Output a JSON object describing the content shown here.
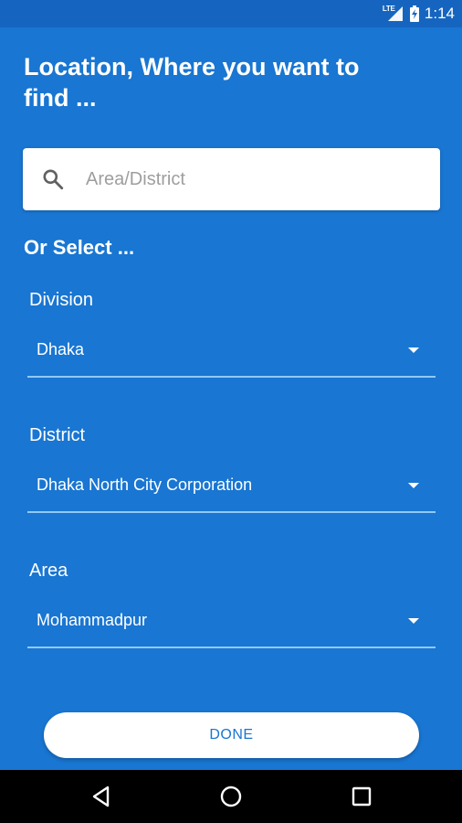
{
  "status_bar": {
    "network": "LTE",
    "time": "1:14"
  },
  "page": {
    "title": "Location, Where you want to find ...",
    "or_select": "Or Select ..."
  },
  "search": {
    "placeholder": "Area/District",
    "value": ""
  },
  "fields": {
    "division": {
      "label": "Division",
      "value": "Dhaka"
    },
    "district": {
      "label": "District",
      "value": "Dhaka North City Corporation"
    },
    "area": {
      "label": "Area",
      "value": "Mohammadpur"
    }
  },
  "done_button": {
    "label": "DONE"
  },
  "colors": {
    "background": "#1976D2",
    "status_bar": "#1565C0",
    "underline": "#90CAF9",
    "button_text": "#1976D2"
  },
  "icons": {
    "search": "search-icon",
    "dropdown": "dropdown-arrow-icon",
    "back": "back-icon",
    "home": "home-icon",
    "recents": "recents-icon",
    "signal": "signal-icon",
    "battery": "battery-charging-icon"
  }
}
